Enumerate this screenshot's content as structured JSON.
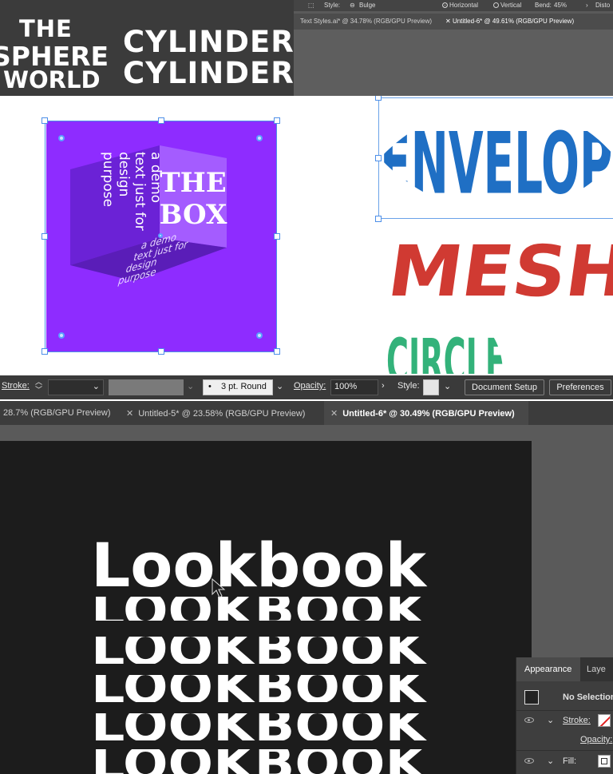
{
  "top_left": {
    "the": "THE",
    "sphere": "SPHERE",
    "world": "WORLD",
    "cylinder_1": "CYLINDER",
    "cylinder_2": "CYLINDER"
  },
  "top_right": {
    "toolbar": {
      "style_label": "Style:",
      "style_value": "Bulge",
      "horizontal_label": "Horizontal",
      "vertical_label": "Vertical",
      "bend_label": "Bend:",
      "bend_value": "45%",
      "distort_label": "Disto"
    },
    "tabs": [
      {
        "label": "Text Styles.ai* @ 34.78% (RGB/GPU Preview)"
      },
      {
        "label": "Untitled-6* @ 49.61% (RGB/GPU Preview)"
      }
    ]
  },
  "artboard": {
    "box_front_line1": "THE",
    "box_front_line2": "BOX",
    "box_side_lines": [
      "a demo",
      "text just for",
      "design",
      "purpose"
    ],
    "box_bottom_lines": [
      "a demo",
      "text just for",
      "design",
      "purpose"
    ],
    "envelope_word": "ENVELOPE",
    "mesh_word": "MESH",
    "circle_word": "CIRCLE",
    "colors": {
      "purple": "#8e2cff",
      "envelope_blue": "#1f6fc4",
      "mesh_red": "#d03a32",
      "circle_green": "#33b27a"
    }
  },
  "control_bar": {
    "stroke_label": "Stroke:",
    "brush_value": "3 pt. Round",
    "opacity_label": "Opacity:",
    "opacity_value": "100%",
    "style_label": "Style:",
    "document_setup": "Document Setup",
    "preferences": "Preferences"
  },
  "bottom_tabs": [
    {
      "label": "28.7% (RGB/GPU Preview)",
      "active": false
    },
    {
      "label": "Untitled-5* @ 23.58% (RGB/GPU Preview)",
      "active": false
    },
    {
      "label": "Untitled-6* @ 30.49% (RGB/GPU Preview)",
      "active": true
    }
  ],
  "workspace": {
    "lookbook_lines": [
      "Lookbook",
      "LOOKBOOK",
      "LOOKBOOK",
      "LOOKBOOK",
      "LOOKBOOK",
      "LOOKBOOK"
    ]
  },
  "appearance_panel": {
    "tab_appearance": "Appearance",
    "tab_layers": "Laye",
    "no_selection": "No Selection",
    "stroke_label": "Stroke:",
    "opacity_label": "Opacity:",
    "fill_label": "Fill:"
  }
}
